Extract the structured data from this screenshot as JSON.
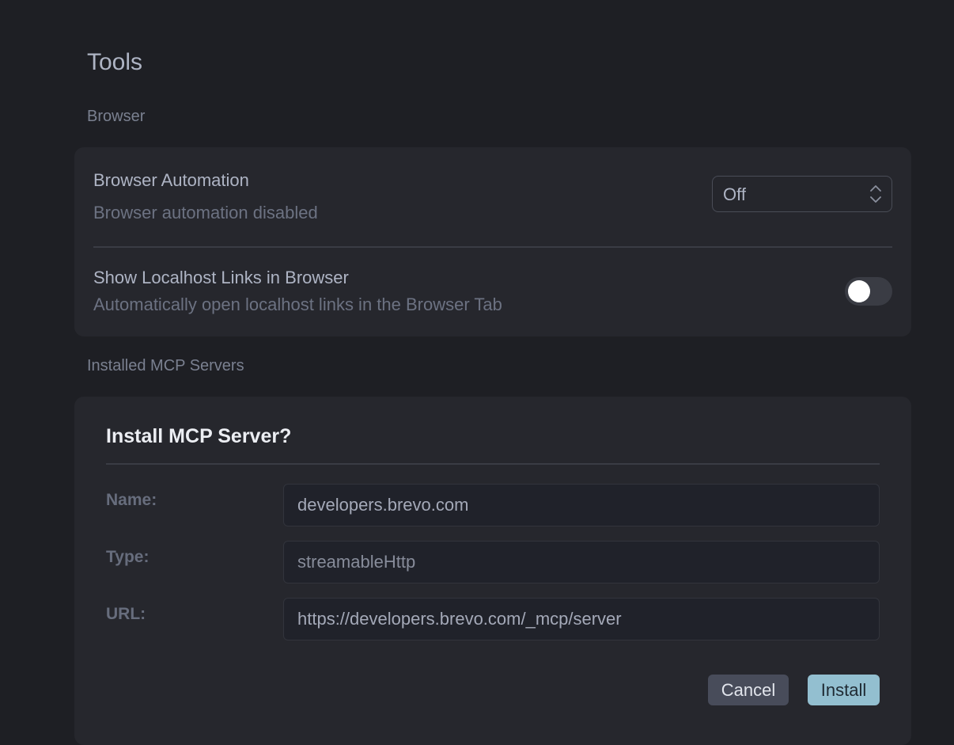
{
  "page": {
    "title": "Tools"
  },
  "browser_section": {
    "label": "Browser",
    "automation": {
      "title": "Browser Automation",
      "description": "Browser automation disabled",
      "select_value": "Off"
    },
    "localhost_links": {
      "title": "Show Localhost Links in Browser",
      "description": "Automatically open localhost links in the Browser Tab",
      "enabled": false
    }
  },
  "mcp_section": {
    "label": "Installed MCP Servers"
  },
  "install_dialog": {
    "title": "Install MCP Server?",
    "fields": {
      "name_label": "Name:",
      "name_value": "developers.brevo.com",
      "type_label": "Type:",
      "type_value": "streamableHttp",
      "url_label": "URL:",
      "url_value": "https://developers.brevo.com/_mcp/server"
    },
    "cancel_label": "Cancel",
    "install_label": "Install"
  },
  "icons": {
    "select_chevrons": "chevron-up-down-icon"
  },
  "colors": {
    "background": "#1e1f24",
    "card": "#26272d",
    "accent": "#93bfd0",
    "secondary_button": "#484c5a"
  }
}
